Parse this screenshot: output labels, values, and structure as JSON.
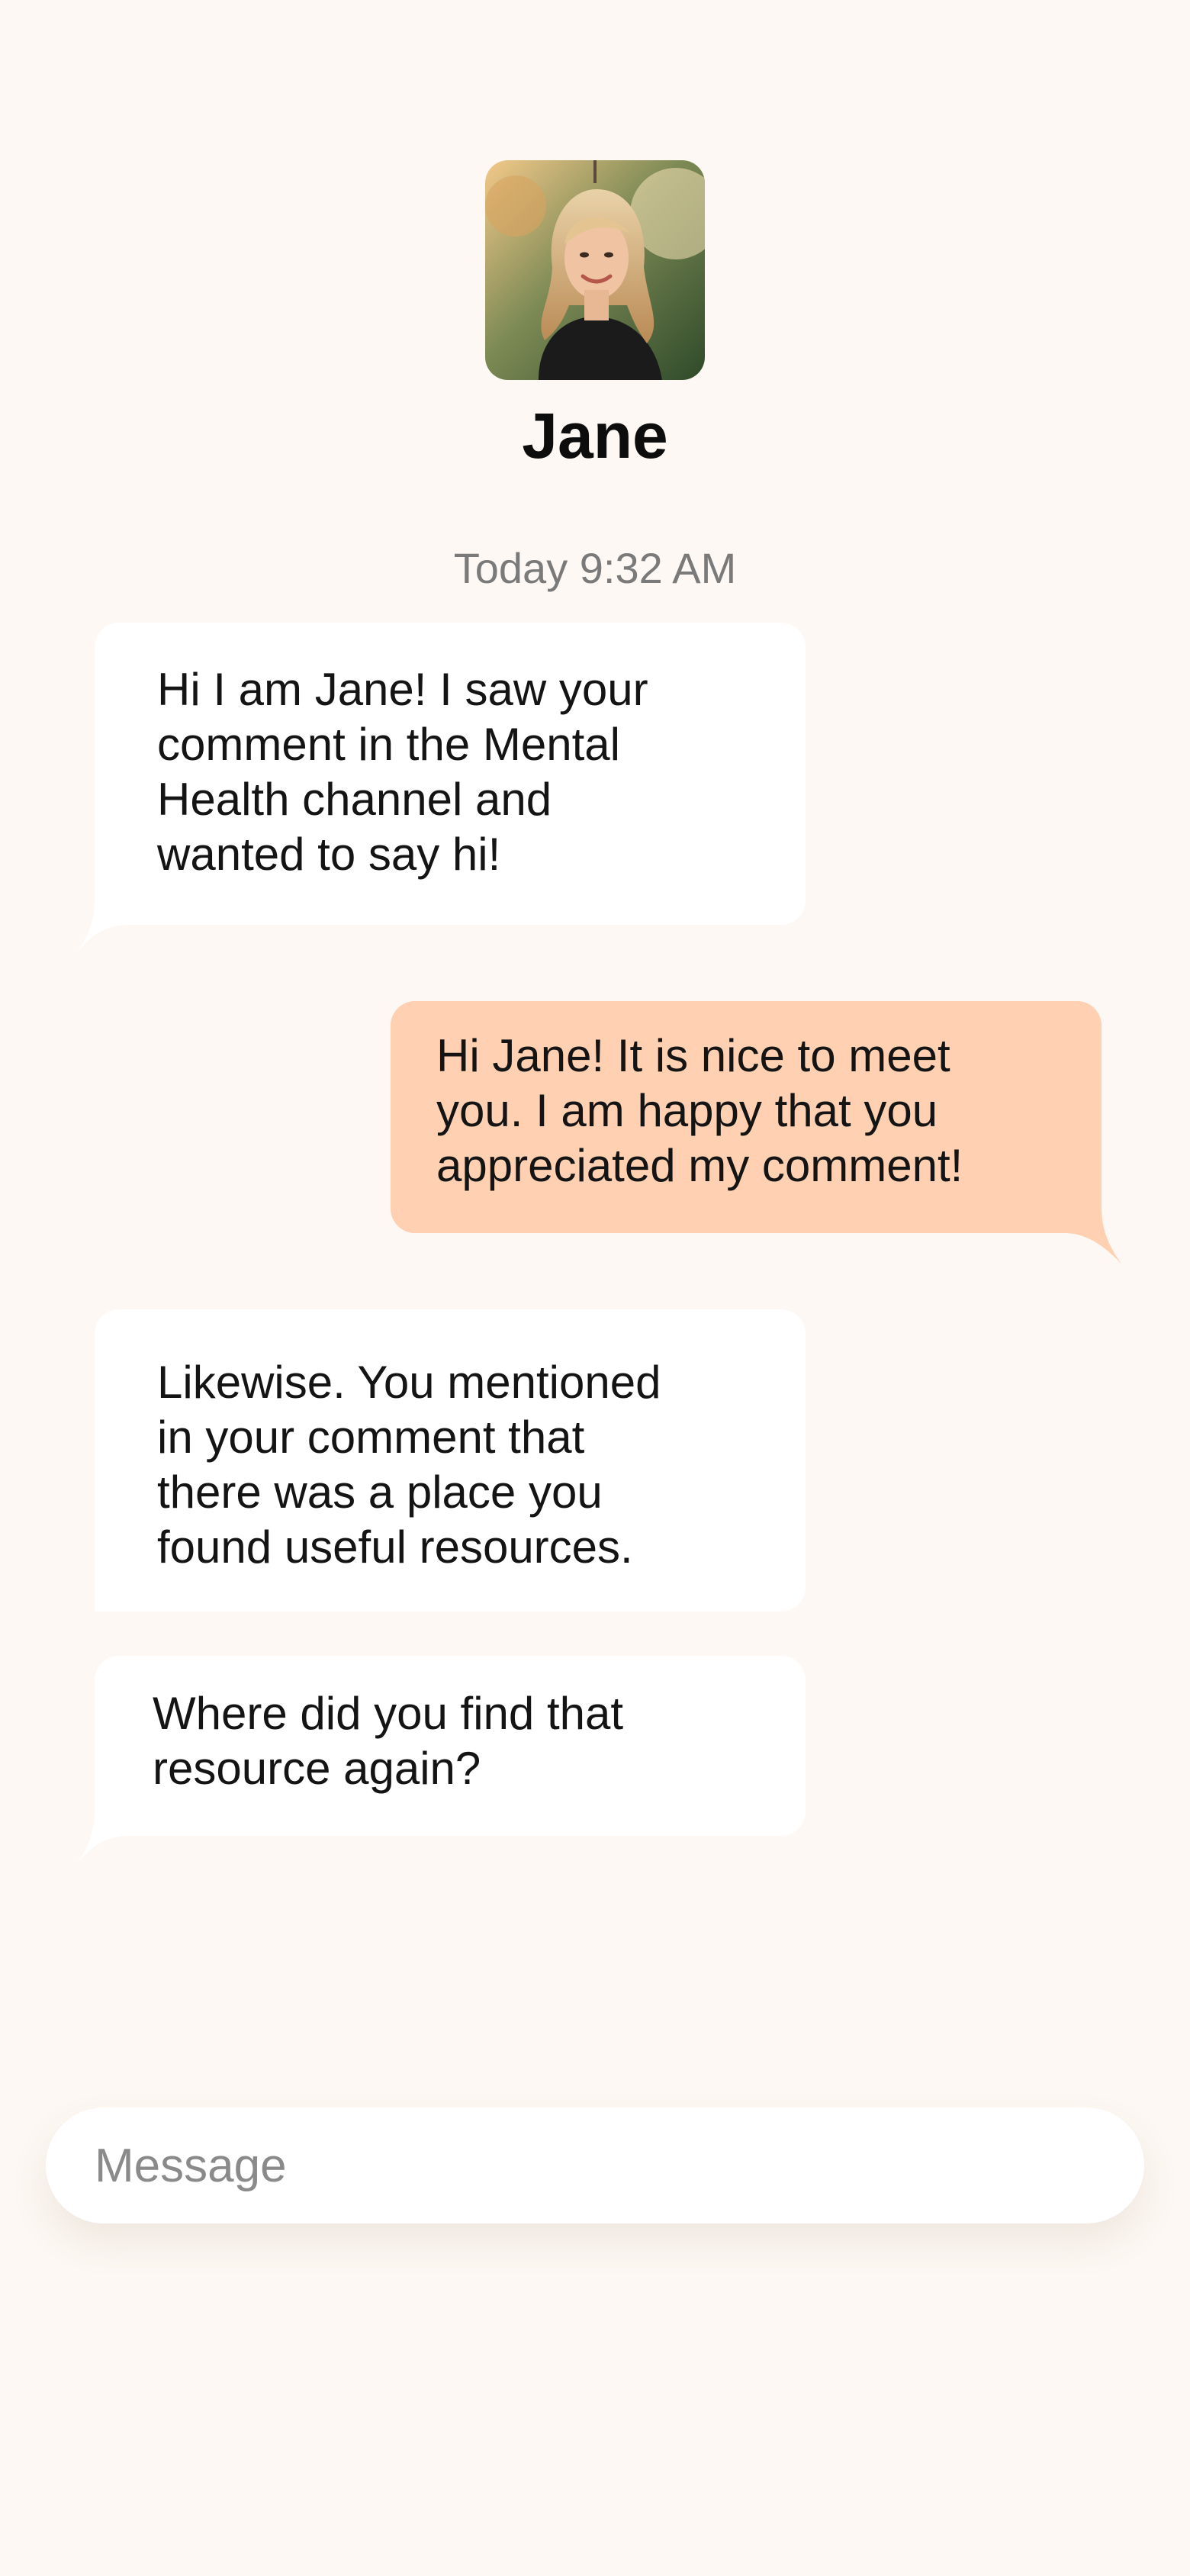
{
  "contact": {
    "name": "Jane",
    "avatar_alt": "Jane"
  },
  "conversation": {
    "timestamp": "Today 9:32 AM",
    "messages": [
      {
        "direction": "incoming",
        "text": "Hi I am Jane! I saw your\ncomment in the Mental\nHealth channel and\nwanted to say hi!"
      },
      {
        "direction": "outgoing",
        "text": "Hi Jane! It is nice to meet\nyou. I am happy that you\nappreciated my comment!"
      },
      {
        "direction": "incoming",
        "text": "Likewise. You mentioned\nin your comment that\nthere was a place you\nfound useful resources."
      },
      {
        "direction": "incoming",
        "text": "Where did you find that\nresource again?"
      }
    ]
  },
  "composer": {
    "placeholder": "Message",
    "value": ""
  },
  "colors": {
    "background": "#fdf8f3",
    "incoming_bubble": "#ffffff",
    "outgoing_bubble": "#ffd0b1",
    "muted_text": "#7a7a7a"
  }
}
